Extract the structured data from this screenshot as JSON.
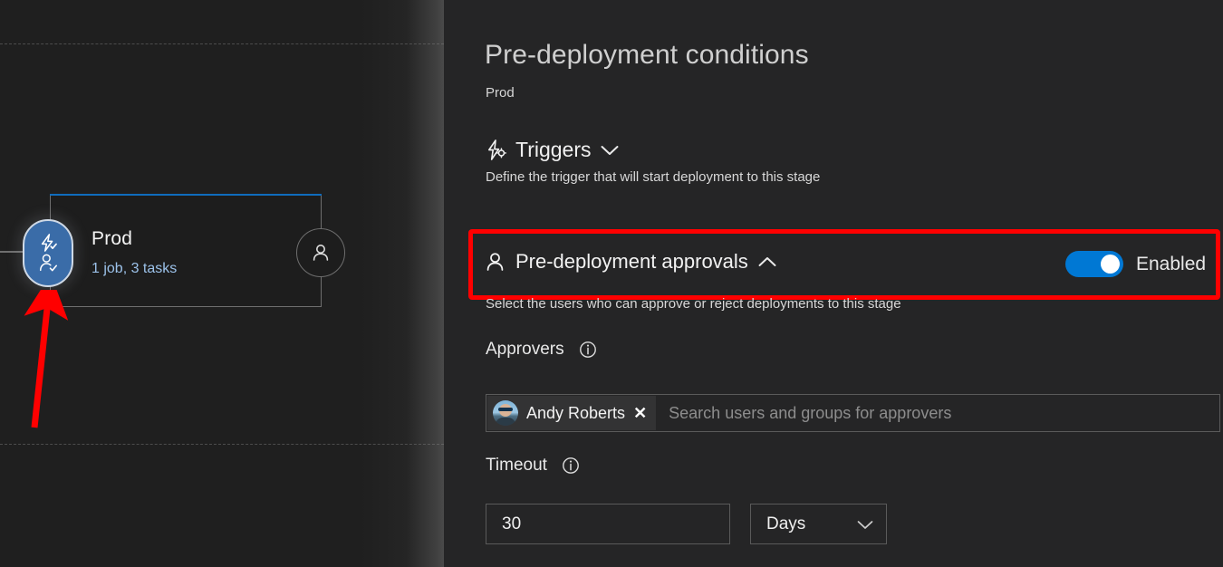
{
  "colors": {
    "accent_blue": "#0078d4",
    "stage_bar_blue": "#0f6cbd",
    "badge_blue": "#3a6ca8",
    "highlight_red": "#ff0000",
    "left_pane_bg": "#1f1f1f",
    "right_pane_bg": "#252526",
    "link_blue": "#9cc2ea"
  },
  "canvas": {
    "stage": {
      "name": "Prod",
      "summary": "1 job, 3 tasks",
      "pre_deployment_badge_icons": [
        "lightning-check-icon",
        "person-check-icon"
      ],
      "post_deployment_badge_icon": "person-icon"
    },
    "annotation": {
      "arrow": "red-arrow-pointing-to-pre-deployment-badge",
      "arrow_color": "#ff0000"
    }
  },
  "detail": {
    "title": "Pre-deployment conditions",
    "subtitle": "Prod",
    "triggers": {
      "icon": "trigger-lightning-gear-icon",
      "label": "Triggers",
      "chevron": "chevron-down-icon",
      "description": "Define the trigger that will start deployment to this stage"
    },
    "approvals": {
      "icon": "person-icon",
      "label": "Pre-deployment approvals",
      "chevron": "chevron-up-icon",
      "toggle_state": "Enabled",
      "toggle_on": true,
      "description": "Select the users who can approve or reject deployments to this stage",
      "approvers": {
        "label": "Approvers",
        "info_icon": "info-icon",
        "selected": [
          {
            "name": "Andy Roberts",
            "remove_label": "✕"
          }
        ],
        "placeholder": "Search users and groups for approvers"
      },
      "timeout": {
        "label": "Timeout",
        "info_icon": "info-icon",
        "value": "30",
        "unit": "Days",
        "unit_chevron": "chevron-down-icon"
      }
    }
  }
}
